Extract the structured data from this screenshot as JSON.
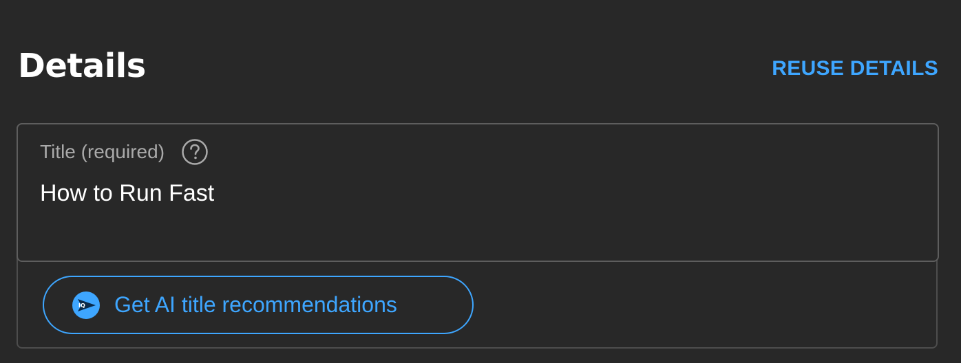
{
  "section": {
    "title": "Details",
    "reuse_label": "REUSE DETAILS"
  },
  "title_field": {
    "label": "Title (required)",
    "value": "How to Run Fast",
    "help_icon": "question-circle-icon"
  },
  "ai_button": {
    "label": "Get AI title recommendations",
    "icon": "ai-sparkle-icon",
    "icon_text": "IQ"
  },
  "colors": {
    "background": "#282828",
    "accent": "#3ea6ff",
    "border": "#5e5e5e",
    "label": "#aaaaaa",
    "text": "#ffffff"
  }
}
